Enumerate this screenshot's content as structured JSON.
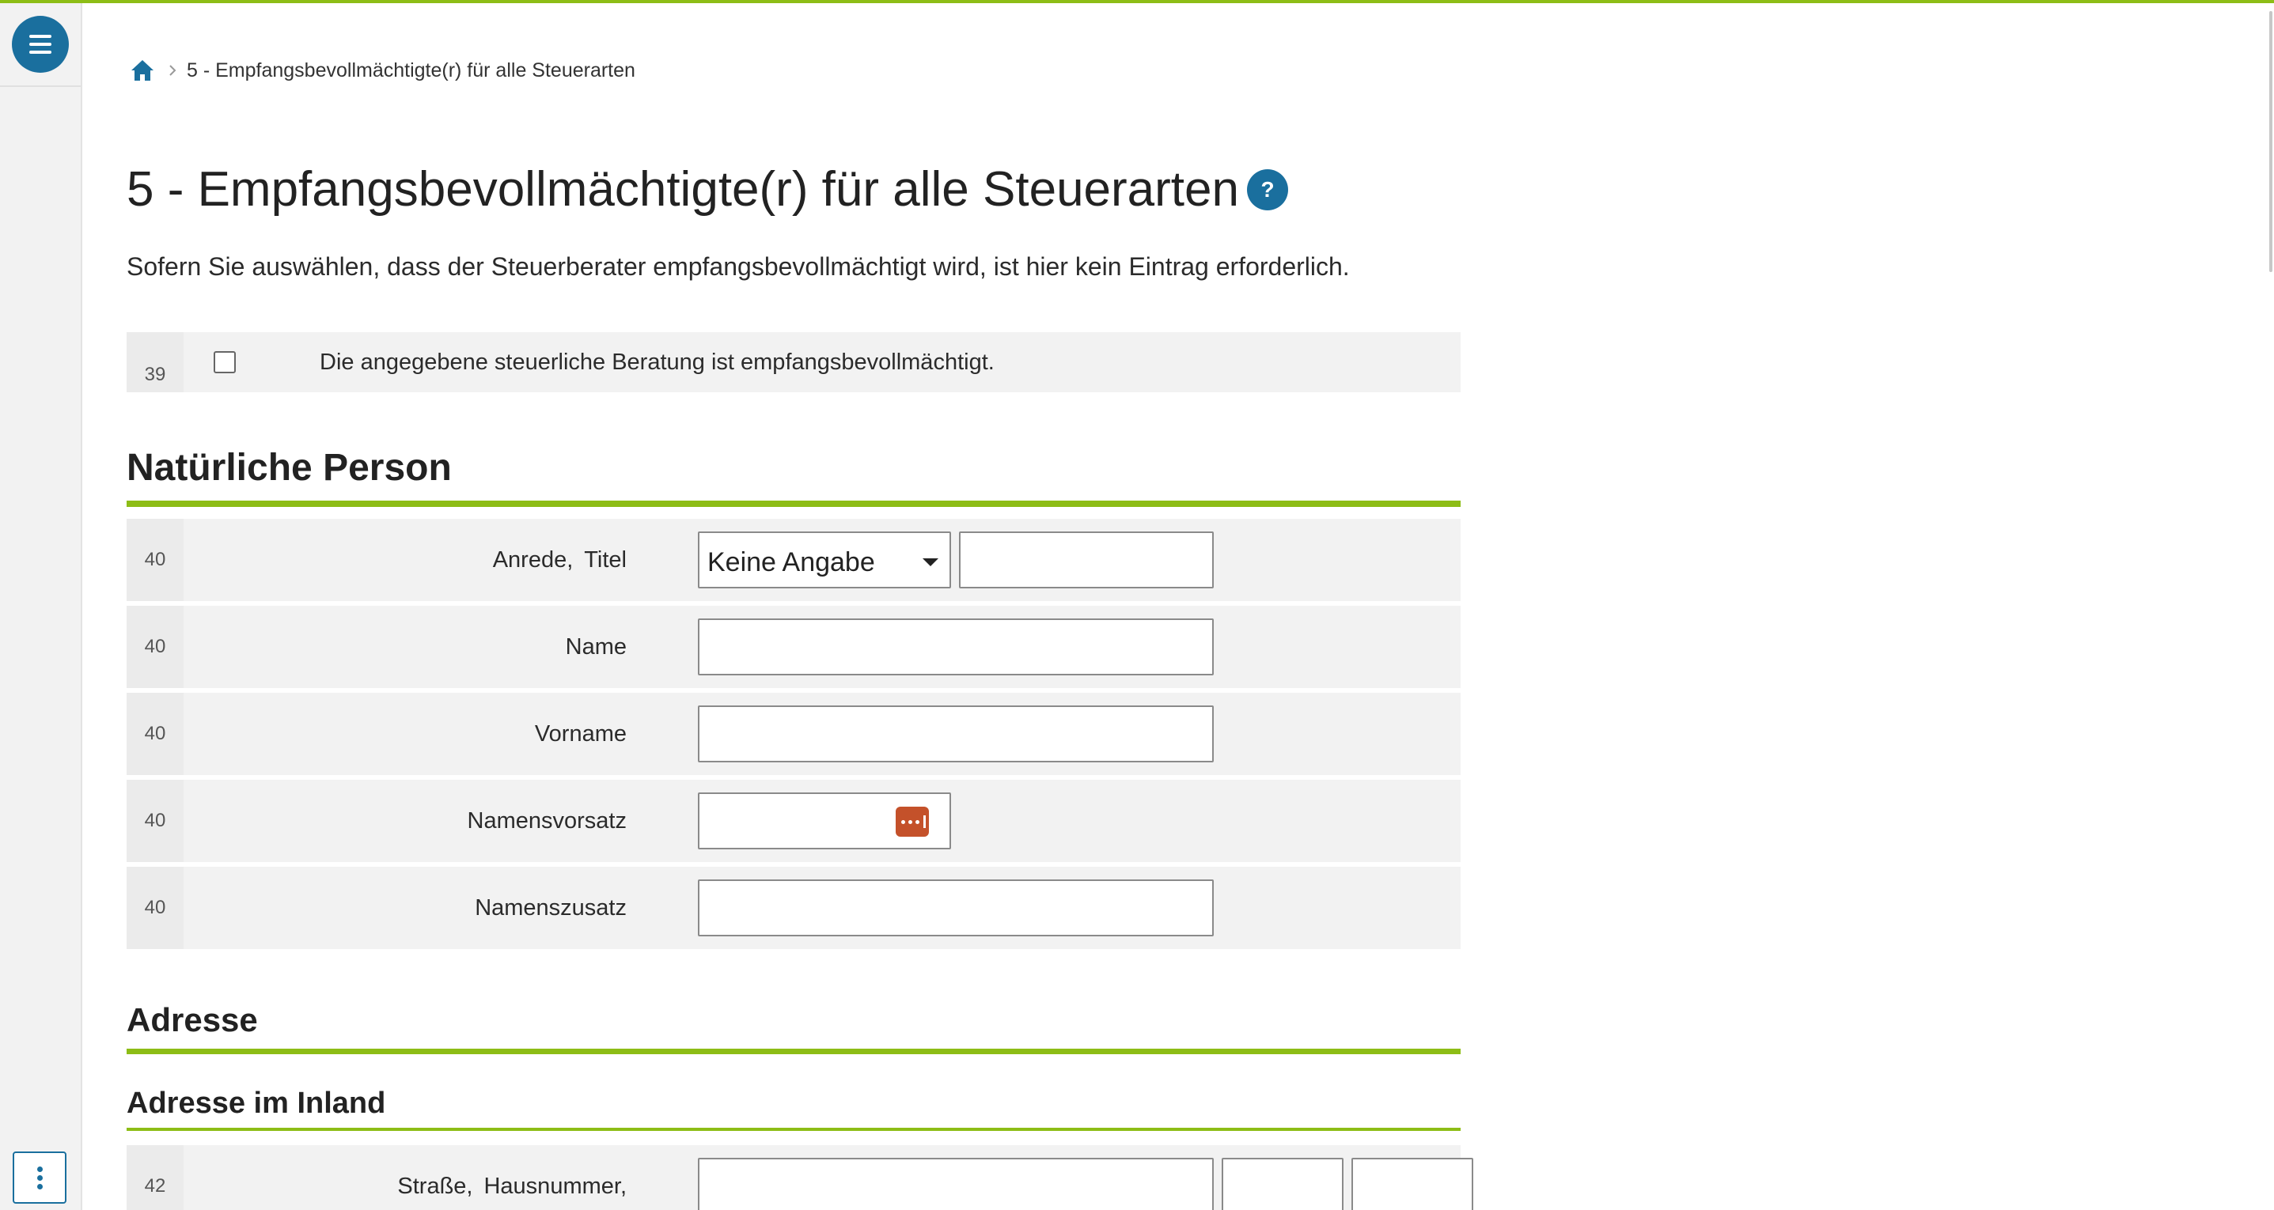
{
  "colors": {
    "accent": "#8dbd16",
    "brand": "#1a6f9e",
    "password_icon": "#c4512a"
  },
  "sidebar": {
    "menu_icon": "hamburger-icon",
    "more_icon": "vertical-dots-icon"
  },
  "breadcrumb": {
    "home_icon": "home-icon",
    "separator_icon": "chevron-right-icon",
    "current": "5 - Empfangsbevollmächtigte(r) für alle Steuerarten"
  },
  "page": {
    "title": "5 - Empfangsbevollmächtigte(r) für alle Steuerarten",
    "help_label": "?",
    "intro": "Sofern Sie auswählen, dass der Steuerberater empfangsbevollmächtigt wird, ist hier kein Eintrag erforderlich."
  },
  "checkbox_row": {
    "number": "39",
    "label": "Die angegebene steuerliche Beratung ist empfangsbevollmächtigt.",
    "checked": false
  },
  "natural_person": {
    "heading": "Natürliche Person",
    "rows": [
      {
        "number": "40",
        "label_1": "Anrede,",
        "label_2": "Titel",
        "anrede_value": "Keine Angabe",
        "titel_value": ""
      },
      {
        "number": "40",
        "label": "Name",
        "value": ""
      },
      {
        "number": "40",
        "label": "Vorname",
        "value": ""
      },
      {
        "number": "40",
        "label": "Namensvorsatz",
        "value": ""
      },
      {
        "number": "40",
        "label": "Namenszusatz",
        "value": ""
      }
    ]
  },
  "address": {
    "heading": "Adresse",
    "subheading": "Adresse im Inland",
    "rows": [
      {
        "number": "42",
        "label_1": "Straße,",
        "label_2": "Hausnummer,",
        "street": "",
        "house_number": "",
        "addition": ""
      }
    ]
  }
}
